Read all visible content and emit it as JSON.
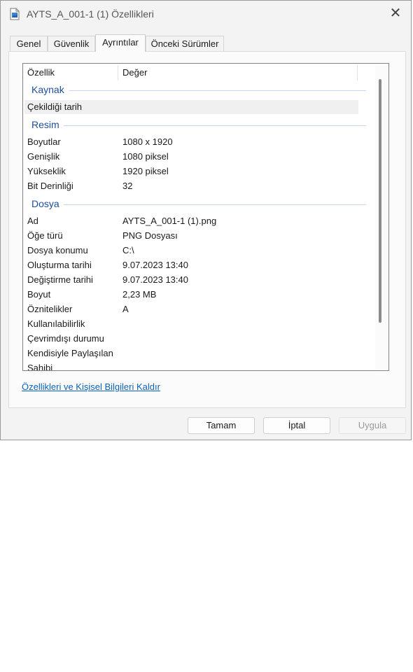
{
  "window": {
    "title": "AYTS_A_001-1 (1) Özellikleri",
    "close_symbol": "✕"
  },
  "tabs": [
    {
      "label": "Genel",
      "active": false
    },
    {
      "label": "Güvenlik",
      "active": false
    },
    {
      "label": "Ayrıntılar",
      "active": true
    },
    {
      "label": "Önceki Sürümler",
      "active": false
    }
  ],
  "details": {
    "columns": {
      "property": "Özellik",
      "value": "Değer"
    },
    "groups": {
      "kaynak": "Kaynak",
      "resim": "Resim",
      "dosya": "Dosya"
    },
    "rows": {
      "cekildigi_tarih": {
        "label": "Çekildiği tarih",
        "value": ""
      },
      "boyutlar": {
        "label": "Boyutlar",
        "value": "1080 x 1920"
      },
      "genislik": {
        "label": "Genişlik",
        "value": "1080 piksel"
      },
      "yukseklik": {
        "label": "Yükseklik",
        "value": "1920 piksel"
      },
      "bit_derinligi": {
        "label": "Bit Derinliği",
        "value": "32"
      },
      "ad": {
        "label": "Ad",
        "value": "AYTS_A_001-1 (1).png"
      },
      "oge_turu": {
        "label": "Öğe türü",
        "value": "PNG Dosyası"
      },
      "dosya_konumu": {
        "label": "Dosya konumu",
        "value": "C:\\"
      },
      "olusturma_tarihi": {
        "label": "Oluşturma tarihi",
        "value": "9.07.2023 13:40"
      },
      "degistirme_tarihi": {
        "label": "Değiştirme tarihi",
        "value": "9.07.2023 13:40"
      },
      "boyut": {
        "label": "Boyut",
        "value": "2,23 MB"
      },
      "oznitelikler": {
        "label": "Öznitelikler",
        "value": "A"
      },
      "kullanilabilirlik": {
        "label": "Kullanılabilirlik",
        "value": ""
      },
      "cevrimdisi": {
        "label": "Çevrimdışı durumu",
        "value": ""
      },
      "paylasilan": {
        "label": "Kendisiyle Paylaşılan",
        "value": ""
      },
      "sahibi": {
        "label": "Sahibi",
        "value": ""
      }
    }
  },
  "remove_link": "Özellikleri ve Kişisel Bilgileri Kaldır",
  "buttons": {
    "ok": "Tamam",
    "cancel": "İptal",
    "apply": "Uygula"
  },
  "colors": {
    "group_header": "#1d4e9a",
    "link": "#0a63b8"
  },
  "icons": {
    "title": "image-file-icon",
    "close": "close-icon"
  }
}
